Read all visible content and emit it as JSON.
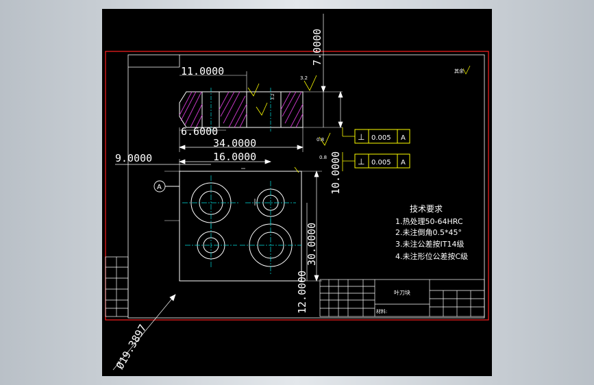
{
  "colors": {
    "background_outer": "#cfd4d9",
    "canvas": "#000000",
    "border": "#ff2020",
    "lines": "#ffffff",
    "hatch": "#d03ad0",
    "gdt": "#ffff00",
    "centerline": "#00e0e0",
    "dimension": "#ffffff"
  },
  "dimensions": {
    "d_7": "7.0000",
    "d_11": "11.0000",
    "d_6_6": "6.6000",
    "d_34": "34.0000",
    "d_9": "9.0000",
    "d_16": "16.0000",
    "d_10": "10.0000",
    "d_30": "30.0000",
    "d_12": "12.0000",
    "d_dia": "Ø19.3897"
  },
  "gdt": {
    "frame1": {
      "symbol": "⊥",
      "tolerance": "0.005",
      "datum": "A"
    },
    "frame2": {
      "symbol": "⊥",
      "tolerance": "0.005",
      "datum": "A"
    },
    "datum_label": "A"
  },
  "roughness": {
    "r1": "3.2",
    "r2": "3.2",
    "r3": "0.8",
    "r4": "0.8"
  },
  "tech_requirements": {
    "title": "技术要求",
    "items": [
      "1.热处理50-64HRC",
      "2.未注倒角0.5*45°",
      "3.未注公差按IT14级",
      "4.未注形位公差按C级"
    ]
  },
  "title_block": {
    "part_name": "叶刀块",
    "material_label": "材料:"
  },
  "corner_symbol": "其余"
}
